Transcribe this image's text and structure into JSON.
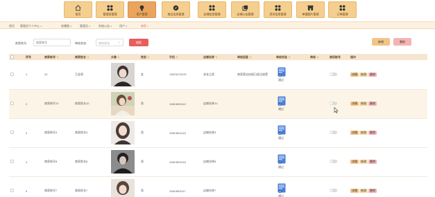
{
  "nav": {
    "items": [
      {
        "label": "首页",
        "icon": "home-icon"
      },
      {
        "label": "管理员管理",
        "icon": "grid-icon"
      },
      {
        "label": "用户管理",
        "icon": "user-icon"
      },
      {
        "label": "商品信息管理",
        "icon": "compass-icon"
      },
      {
        "label": "店铺信息管理",
        "icon": "grid-icon"
      },
      {
        "label": "店铺公告管理",
        "icon": "copy-icon"
      },
      {
        "label": "资讯信息管理",
        "icon": "grid-icon"
      },
      {
        "label": "单据图片管理",
        "icon": "shop-icon"
      },
      {
        "label": "订单管理",
        "icon": "grid-icon"
      }
    ],
    "active_index": 2,
    "colors": {
      "item": "#f5cf8f",
      "active": "#e9a45e"
    }
  },
  "breadcrumb": {
    "items": [
      "首页",
      "管理员个人中心",
      "轮播图",
      "管理员",
      "系统公告",
      "用户",
      "商家"
    ]
  },
  "filter": {
    "merchant_no_label": "商家帐号:",
    "merchant_no_placeholder": "商家帐号",
    "review_label": "审核状态:",
    "review_placeholder": "审核状态",
    "search_label": "搜索"
  },
  "actions": {
    "add_label": "新增",
    "delete_label": "删除"
  },
  "table": {
    "headers": [
      "序号",
      "商家帐号",
      "商家姓名",
      "头像",
      "性别",
      "手机",
      "店铺名称",
      "审核回复",
      "审核状态",
      "审核",
      "禁用账号",
      "操作"
    ],
    "rows": [
      {
        "index": "1",
        "account": "22",
        "name": "王会哥",
        "gender": "女",
        "phone": "13870070079",
        "shop": "非非之家",
        "reply": "商家营业执照已经注册受",
        "status": "通过"
      },
      {
        "index": "2",
        "account": "商家帐号10",
        "name": "商家姓名10",
        "gender": "男",
        "phone": "10819801110",
        "shop": "店铺名称10",
        "reply": "",
        "status": "通过"
      },
      {
        "index": "3",
        "account": "商家帐号3",
        "name": "商家姓名3",
        "gender": "男",
        "phone": "10819801115",
        "shop": "店铺名称3",
        "reply": "",
        "status": "通过"
      },
      {
        "index": "4",
        "account": "商家帐号8",
        "name": "商家姓名8",
        "gender": "男",
        "phone": "10819801116",
        "shop": "店铺名称8",
        "reply": "",
        "status": "通过"
      },
      {
        "index": "5",
        "account": "商家帐号7",
        "name": "商家姓名7",
        "gender": "男",
        "phone": "10819801117",
        "shop": "店铺名称7",
        "reply": "",
        "status": "通过"
      }
    ],
    "ops": {
      "detail": "详情",
      "edit": "修改",
      "delete": "删除"
    }
  }
}
